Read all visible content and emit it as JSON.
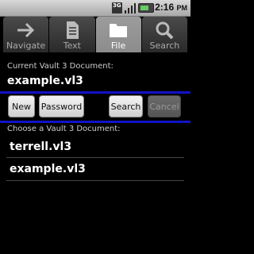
{
  "status_bar": {
    "time": "2:16",
    "time_suffix": "PM",
    "network": "3G",
    "icons": [
      "3g-icon",
      "signal-icon",
      "battery-icon"
    ]
  },
  "tabs": [
    {
      "label": "Navigate",
      "icon": "arrow-right-icon",
      "active": false
    },
    {
      "label": "Text",
      "icon": "document-icon",
      "active": false
    },
    {
      "label": "File",
      "icon": "folder-icon",
      "active": true
    },
    {
      "label": "Search",
      "icon": "magnifier-icon",
      "active": false
    }
  ],
  "current": {
    "label": "Current Vault 3 Document:",
    "document": "example.vl3"
  },
  "buttons": {
    "new": "New",
    "password": "Password",
    "search": "Search",
    "cancel": "Cancel"
  },
  "choose": {
    "label": "Choose a Vault 3 Document:",
    "items": [
      "terrell.vl3",
      "example.vl3"
    ]
  },
  "colors": {
    "divider": "#1212c8",
    "active_tab": "#9c9c9c"
  }
}
